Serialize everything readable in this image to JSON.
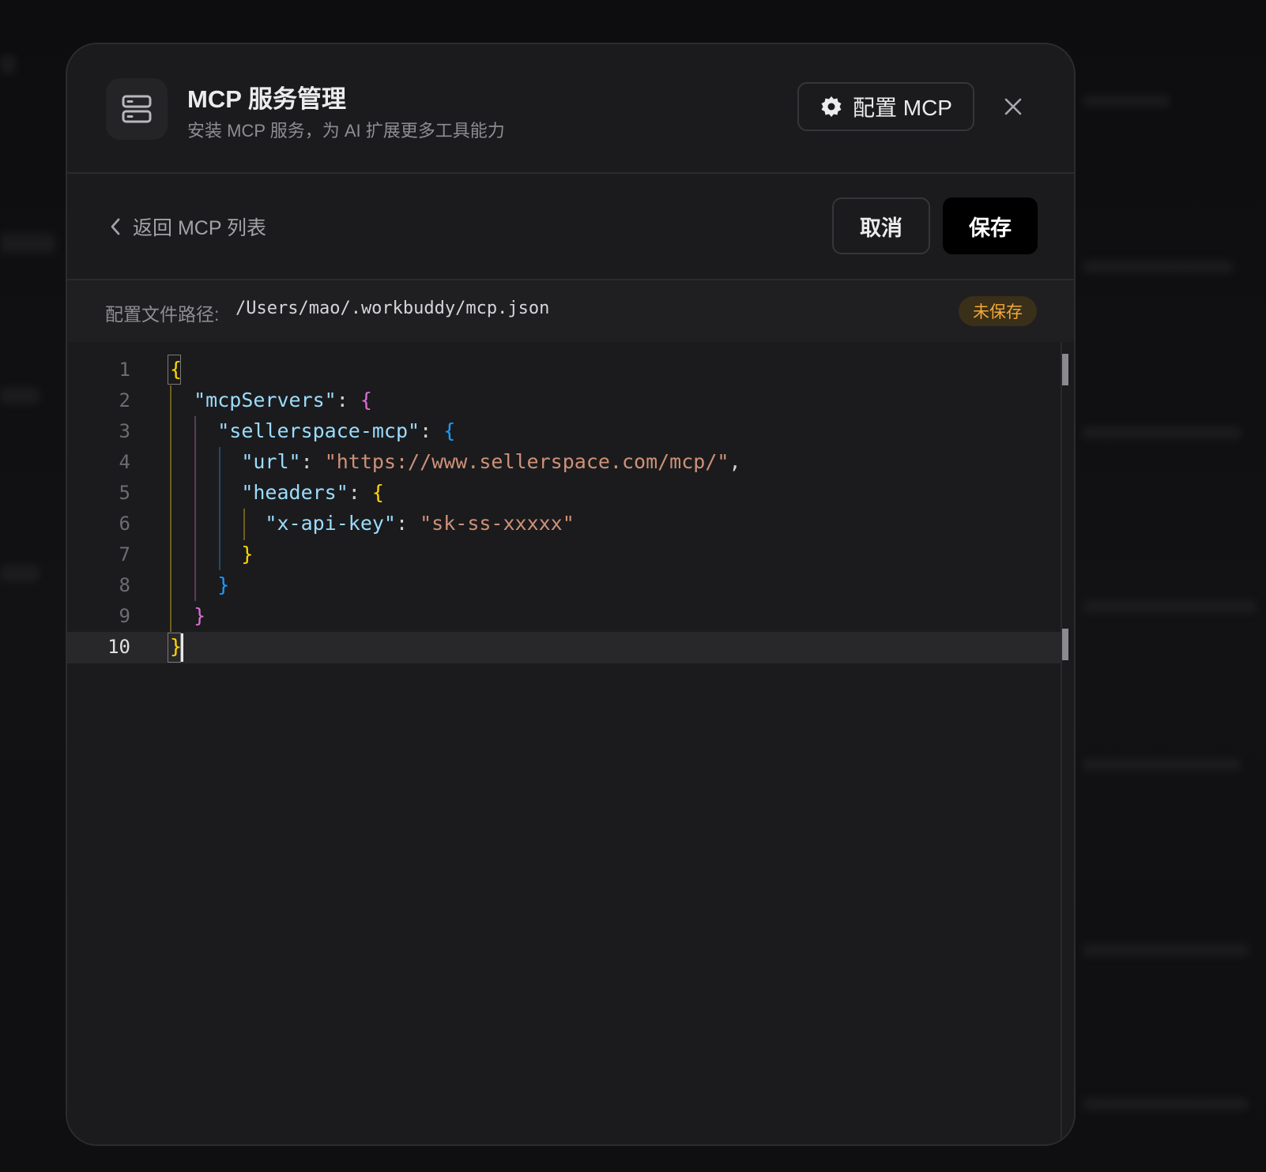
{
  "modal": {
    "title": "MCP 服务管理",
    "subtitle": "安装 MCP 服务，为 AI 扩展更多工具能力",
    "config_button_label": "配置 MCP",
    "header_icon": "server-icon",
    "config_icon": "gear-icon",
    "close_icon": "close-icon"
  },
  "toolbar": {
    "back_label": "返回 MCP 列表",
    "back_icon": "chevron-left-icon",
    "cancel_label": "取消",
    "save_label": "保存"
  },
  "path_bar": {
    "label": "配置文件路径:",
    "value": "/Users/mao/.workbuddy/mcp.json",
    "status_badge": "未保存"
  },
  "editor": {
    "active_line": 10,
    "line_numbers": [
      "1",
      "2",
      "3",
      "4",
      "5",
      "6",
      "7",
      "8",
      "9",
      "10"
    ],
    "lines": [
      "{",
      "  \"mcpServers\": {",
      "    \"sellerspace-mcp\": {",
      "      \"url\": \"https://www.sellerspace.com/mcp/\",",
      "      \"headers\": {",
      "        \"x-api-key\": \"sk-ss-xxxxx\"",
      "      }",
      "    }",
      "  }",
      "}"
    ],
    "tokens": {
      "k_mcpServers": "\"mcpServers\"",
      "k_sellerspace": "\"sellerspace-mcp\"",
      "k_url": "\"url\"",
      "v_url": "\"https://www.sellerspace.com/mcp/\"",
      "k_headers": "\"headers\"",
      "k_apikey": "\"x-api-key\"",
      "v_apikey": "\"sk-ss-xxxxx\""
    }
  },
  "colors": {
    "modal_bg": "#1b1b1d",
    "json_key": "#9cdcfe",
    "json_string": "#ce9178",
    "bracket_level_1": "#ffd700",
    "bracket_level_2": "#da70d6",
    "bracket_level_3": "#179fff",
    "unsaved_badge_text": "#f2a93b",
    "save_button_bg": "#000000"
  }
}
